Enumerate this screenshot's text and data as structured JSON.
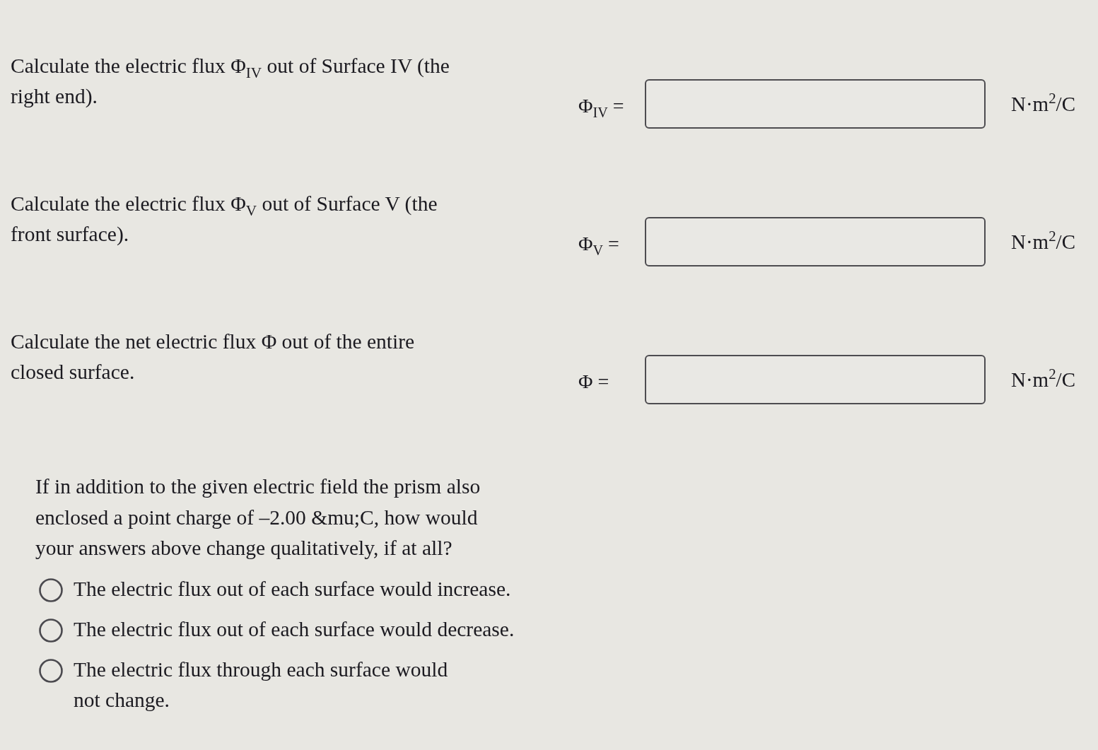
{
  "answer_rows": [
    {
      "prompt": "Calculate the electric flux Φ$_{IV}$ out of Surface IV (the right end).",
      "label": "Φ$_{IV}$ =",
      "unit": "N·m$^{2}$/C"
    },
    {
      "prompt": "Calculate the electric flux Φ$_{V}$ out of Surface V (the front surface).",
      "label": "Φ$_{V}$ =",
      "unit": "N·m$^{2}$/C"
    },
    {
      "prompt": "Calculate the net electric flux Φ out of the entire closed surface.",
      "label": "Φ =",
      "unit": "N·m$^{2}$/C"
    }
  ],
  "question": {
    "text": "If in addition to the given electric field the prism also enclosed a point charge of –2.00 &mu;C, how would your answers above change qualitatively, if at all?",
    "options": [
      {
        "label": "The electric flux out of each surface would increase.",
        "selected": false
      },
      {
        "label": "The electric flux out of each surface would decrease.",
        "selected": false
      },
      {
        "label": "The electric flux through each surface would not change.",
        "selected": false
      }
    ]
  }
}
